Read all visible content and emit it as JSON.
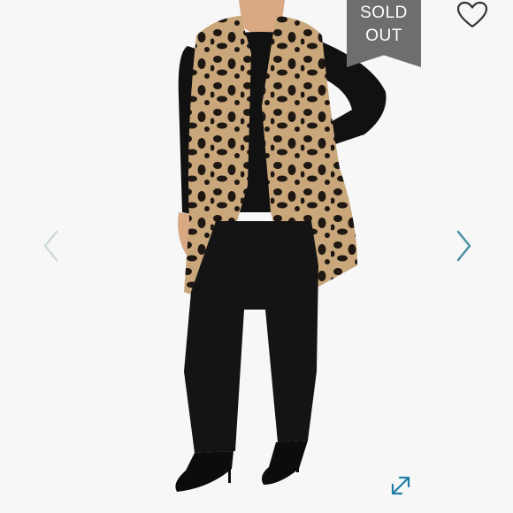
{
  "product_image": {
    "badge": {
      "line1": "SOLD",
      "line2": "OUT"
    },
    "icons": {
      "favorite": "heart-outline-icon",
      "previous": "chevron-left-icon",
      "next": "chevron-right-icon",
      "fullscreen": "expand-arrows-icon"
    },
    "colors": {
      "badge": "#6e6e6e",
      "nav_prev": "#cfd8dc",
      "nav_next": "#4a90a4",
      "expand": "#1f7fa8",
      "vest_base": "#c9a77a",
      "spots": "#1e1712"
    }
  }
}
